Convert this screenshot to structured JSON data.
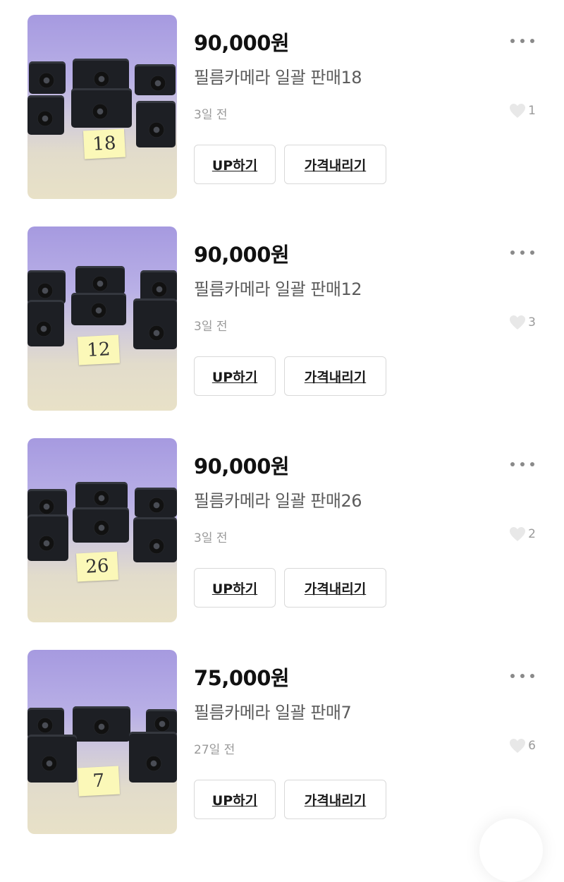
{
  "listings": [
    {
      "price": "90,000원",
      "title": "필름카메라 일괄 판매18",
      "time": "3일 전",
      "likes": "1",
      "note": "18",
      "up_label": "UP하기",
      "price_down_label": "가격내리기"
    },
    {
      "price": "90,000원",
      "title": "필름카메라 일괄 판매12",
      "time": "3일 전",
      "likes": "3",
      "note": "12",
      "up_label": "UP하기",
      "price_down_label": "가격내리기"
    },
    {
      "price": "90,000원",
      "title": "필름카메라 일괄 판매26",
      "time": "3일 전",
      "likes": "2",
      "note": "26",
      "up_label": "UP하기",
      "price_down_label": "가격내리기"
    },
    {
      "price": "75,000원",
      "title": "필름카메라 일괄 판매7",
      "time": "27일 전",
      "likes": "6",
      "note": "7",
      "up_label": "UP하기",
      "price_down_label": "가격내리기"
    }
  ],
  "icons": {
    "more": "more-dots-icon",
    "like": "heart-icon"
  },
  "colors": {
    "text": "#1a1a1a",
    "muted": "#999999",
    "border": "#d9d9d9"
  }
}
